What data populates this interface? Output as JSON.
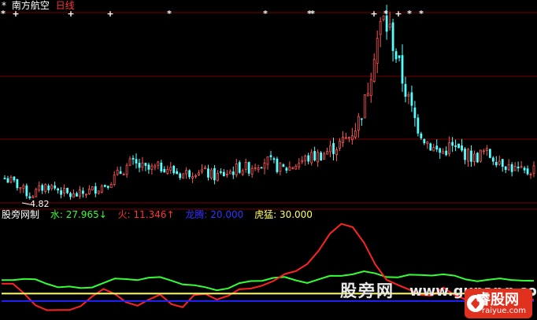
{
  "header": {
    "marker": "*",
    "stock_name": "南方航空",
    "period": "日线",
    "low_label": "4.82"
  },
  "indicator": {
    "name": "股旁网制",
    "items": [
      {
        "label": "水",
        "value": "27.965",
        "arrow": "↓",
        "color": "#33ff33"
      },
      {
        "label": "火",
        "value": "11.346",
        "arrow": "↑",
        "color": "#ff3333"
      },
      {
        "label": "龙腾",
        "value": "20.000",
        "arrow": "",
        "color": "#3333ff"
      },
      {
        "label": "虎猛",
        "value": "30.000",
        "arrow": "",
        "color": "#ffff66"
      }
    ]
  },
  "watermark": {
    "site_cn": "股旁网",
    "site_url": "www.gupang.com",
    "brand": "睿股网",
    "brand_url": "raiyue.com"
  },
  "colors": {
    "up": "#ff5555",
    "down": "#55ffff",
    "grid": "#7a0000",
    "water": "#33ff33",
    "fire": "#ff2222",
    "dragon": "#2222ff",
    "tiger": "#ffff66"
  },
  "chart_data": [
    {
      "type": "candlestick",
      "title": "南方航空 日线",
      "annotations": [
        "4.82"
      ],
      "signals": [
        "+",
        "+",
        "+",
        "*",
        "*",
        "+",
        "*",
        "+",
        "*",
        "*"
      ],
      "trend": [
        40,
        36,
        30,
        22,
        28,
        33,
        30,
        26,
        22,
        24,
        27,
        30,
        34,
        40,
        48,
        55,
        52,
        48,
        50,
        52,
        47,
        44,
        46,
        49,
        45,
        42,
        44,
        47,
        51,
        50,
        55,
        58,
        54,
        49,
        51,
        56,
        60,
        62,
        65,
        70,
        75,
        82,
        95,
        120,
        170,
        200,
        185,
        150,
        120,
        95,
        80,
        70,
        65,
        72,
        68,
        64,
        60,
        66,
        62,
        58,
        52,
        48,
        45,
        50
      ]
    },
    {
      "type": "line",
      "series": [
        {
          "name": "水",
          "values": [
            48,
            50,
            49,
            47,
            44,
            40,
            38,
            36,
            40,
            45,
            48,
            49,
            50,
            51,
            50,
            48,
            44,
            40,
            37,
            36,
            38,
            42,
            46,
            49,
            51,
            50,
            48,
            46,
            48,
            52,
            55,
            57,
            58,
            56,
            54,
            52,
            53,
            55,
            56,
            55,
            52,
            50,
            48,
            47,
            49,
            50,
            48,
            45
          ]
        },
        {
          "name": "火",
          "values": [
            45,
            44,
            28,
            14,
            10,
            8,
            6,
            14,
            28,
            35,
            28,
            20,
            15,
            20,
            28,
            18,
            12,
            26,
            30,
            24,
            26,
            34,
            38,
            42,
            45,
            55,
            62,
            70,
            85,
            110,
            125,
            118,
            96,
            70,
            50,
            40,
            34,
            30,
            28,
            36,
            28,
            24,
            30,
            26,
            22,
            28,
            24,
            20
          ]
        },
        {
          "name": "龙腾",
          "values": [
            20,
            20,
            20,
            20,
            20,
            20,
            20,
            20,
            20,
            20,
            20,
            20,
            20,
            20,
            20,
            20,
            20,
            20,
            20,
            20,
            20,
            20,
            20,
            20,
            20,
            20,
            20,
            20,
            20,
            20,
            20,
            20,
            20,
            20,
            20,
            20,
            20,
            20,
            20,
            20,
            20,
            20,
            20,
            20,
            20,
            20,
            20,
            20
          ]
        },
        {
          "name": "虎猛",
          "values": [
            30,
            30,
            30,
            30,
            30,
            30,
            30,
            30,
            30,
            30,
            30,
            30,
            30,
            30,
            30,
            30,
            30,
            30,
            30,
            30,
            30,
            30,
            30,
            30,
            30,
            30,
            30,
            30,
            30,
            30,
            30,
            30,
            30,
            30,
            30,
            30,
            30,
            30,
            30,
            30,
            30,
            30,
            30,
            30,
            30,
            30,
            30,
            30
          ]
        }
      ]
    }
  ]
}
